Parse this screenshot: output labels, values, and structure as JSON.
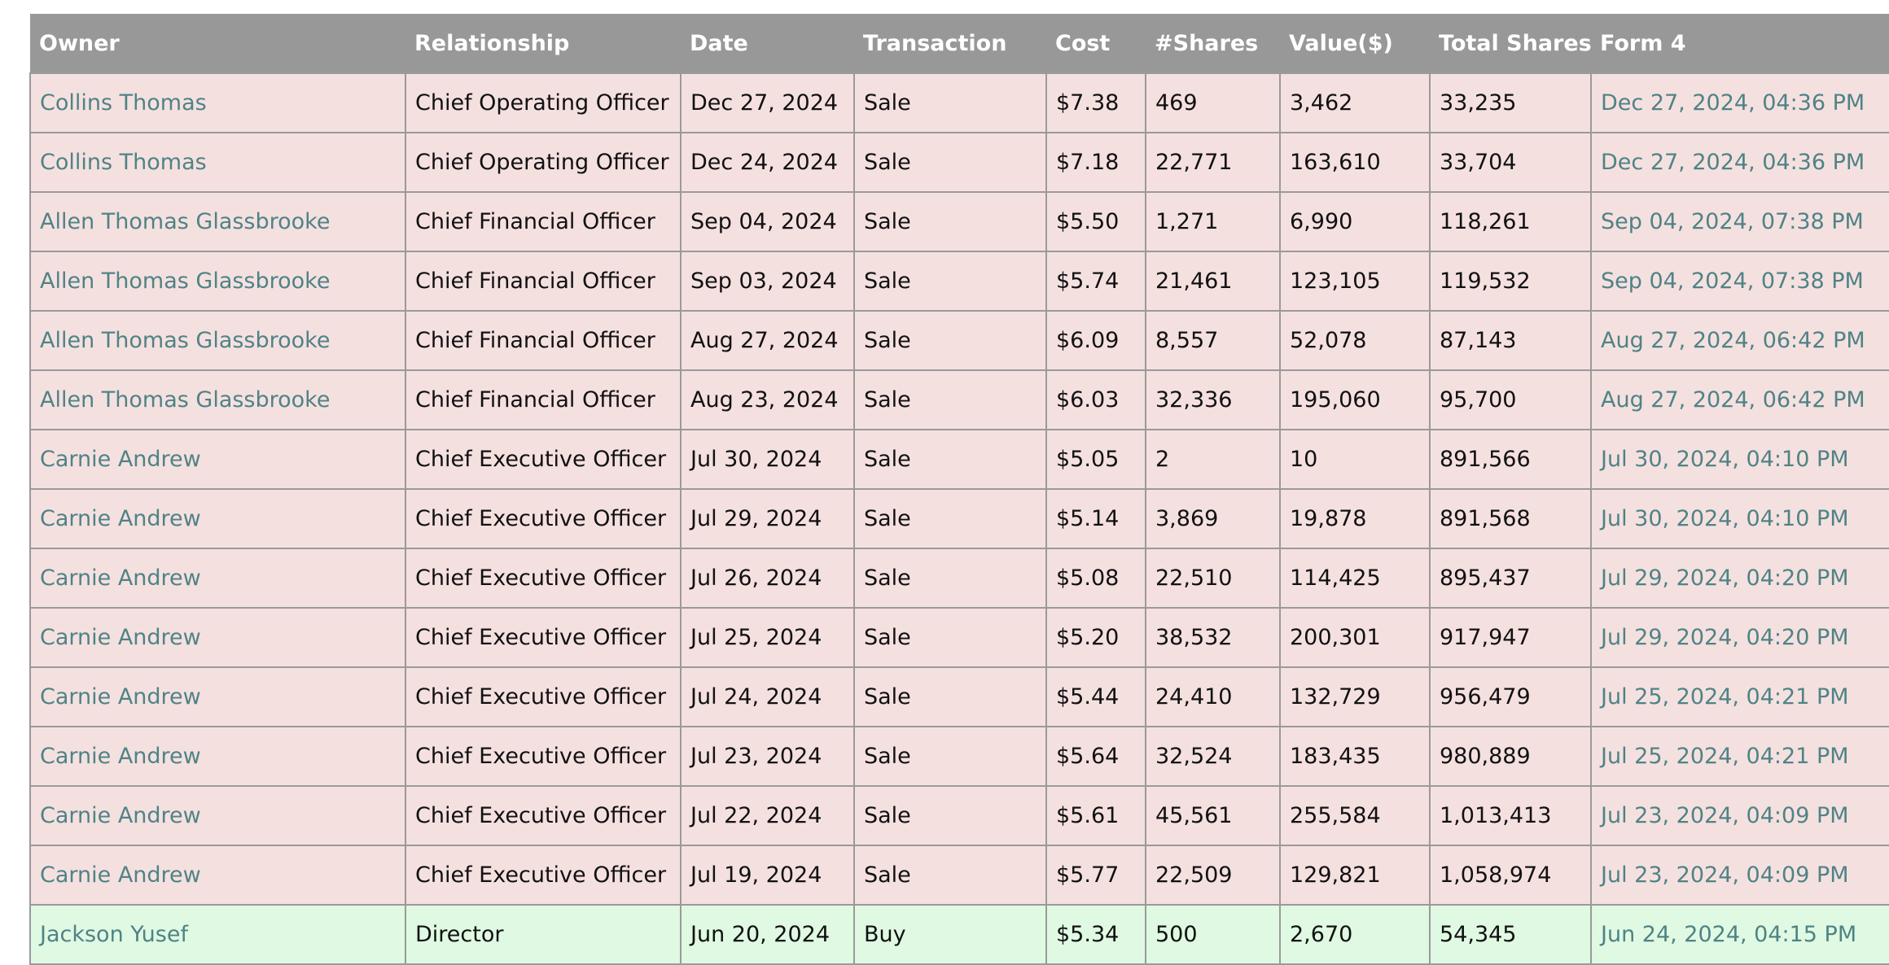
{
  "columns": [
    "Owner",
    "Relationship",
    "Date",
    "Transaction",
    "Cost",
    "#Shares",
    "Value($)",
    "Total Shares",
    "Form 4"
  ],
  "colors": {
    "header_bg": "#989898",
    "sale_row_bg": "#f5e0e0",
    "buy_row_bg": "#dff9e3",
    "link_text": "#4f8385",
    "border": "#9a9a9a"
  },
  "rows": [
    {
      "owner": "Collins Thomas",
      "relationship": "Chief Operating Officer",
      "date": "Dec 27, 2024",
      "transaction": "Sale",
      "cost": "$7.38",
      "shares": "469",
      "value": "3,462",
      "total_shares": "33,235",
      "form4": "Dec 27, 2024, 04:36 PM"
    },
    {
      "owner": "Collins Thomas",
      "relationship": "Chief Operating Officer",
      "date": "Dec 24, 2024",
      "transaction": "Sale",
      "cost": "$7.18",
      "shares": "22,771",
      "value": "163,610",
      "total_shares": "33,704",
      "form4": "Dec 27, 2024, 04:36 PM"
    },
    {
      "owner": "Allen Thomas Glassbrooke",
      "relationship": "Chief Financial Officer",
      "date": "Sep 04, 2024",
      "transaction": "Sale",
      "cost": "$5.50",
      "shares": "1,271",
      "value": "6,990",
      "total_shares": "118,261",
      "form4": "Sep 04, 2024, 07:38 PM"
    },
    {
      "owner": "Allen Thomas Glassbrooke",
      "relationship": "Chief Financial Officer",
      "date": "Sep 03, 2024",
      "transaction": "Sale",
      "cost": "$5.74",
      "shares": "21,461",
      "value": "123,105",
      "total_shares": "119,532",
      "form4": "Sep 04, 2024, 07:38 PM"
    },
    {
      "owner": "Allen Thomas Glassbrooke",
      "relationship": "Chief Financial Officer",
      "date": "Aug 27, 2024",
      "transaction": "Sale",
      "cost": "$6.09",
      "shares": "8,557",
      "value": "52,078",
      "total_shares": "87,143",
      "form4": "Aug 27, 2024, 06:42 PM"
    },
    {
      "owner": "Allen Thomas Glassbrooke",
      "relationship": "Chief Financial Officer",
      "date": "Aug 23, 2024",
      "transaction": "Sale",
      "cost": "$6.03",
      "shares": "32,336",
      "value": "195,060",
      "total_shares": "95,700",
      "form4": "Aug 27, 2024, 06:42 PM"
    },
    {
      "owner": "Carnie Andrew",
      "relationship": "Chief Executive Officer",
      "date": "Jul 30, 2024",
      "transaction": "Sale",
      "cost": "$5.05",
      "shares": "2",
      "value": "10",
      "total_shares": "891,566",
      "form4": "Jul 30, 2024, 04:10 PM"
    },
    {
      "owner": "Carnie Andrew",
      "relationship": "Chief Executive Officer",
      "date": "Jul 29, 2024",
      "transaction": "Sale",
      "cost": "$5.14",
      "shares": "3,869",
      "value": "19,878",
      "total_shares": "891,568",
      "form4": "Jul 30, 2024, 04:10 PM"
    },
    {
      "owner": "Carnie Andrew",
      "relationship": "Chief Executive Officer",
      "date": "Jul 26, 2024",
      "transaction": "Sale",
      "cost": "$5.08",
      "shares": "22,510",
      "value": "114,425",
      "total_shares": "895,437",
      "form4": "Jul 29, 2024, 04:20 PM"
    },
    {
      "owner": "Carnie Andrew",
      "relationship": "Chief Executive Officer",
      "date": "Jul 25, 2024",
      "transaction": "Sale",
      "cost": "$5.20",
      "shares": "38,532",
      "value": "200,301",
      "total_shares": "917,947",
      "form4": "Jul 29, 2024, 04:20 PM"
    },
    {
      "owner": "Carnie Andrew",
      "relationship": "Chief Executive Officer",
      "date": "Jul 24, 2024",
      "transaction": "Sale",
      "cost": "$5.44",
      "shares": "24,410",
      "value": "132,729",
      "total_shares": "956,479",
      "form4": "Jul 25, 2024, 04:21 PM"
    },
    {
      "owner": "Carnie Andrew",
      "relationship": "Chief Executive Officer",
      "date": "Jul 23, 2024",
      "transaction": "Sale",
      "cost": "$5.64",
      "shares": "32,524",
      "value": "183,435",
      "total_shares": "980,889",
      "form4": "Jul 25, 2024, 04:21 PM"
    },
    {
      "owner": "Carnie Andrew",
      "relationship": "Chief Executive Officer",
      "date": "Jul 22, 2024",
      "transaction": "Sale",
      "cost": "$5.61",
      "shares": "45,561",
      "value": "255,584",
      "total_shares": "1,013,413",
      "form4": "Jul 23, 2024, 04:09 PM"
    },
    {
      "owner": "Carnie Andrew",
      "relationship": "Chief Executive Officer",
      "date": "Jul 19, 2024",
      "transaction": "Sale",
      "cost": "$5.77",
      "shares": "22,509",
      "value": "129,821",
      "total_shares": "1,058,974",
      "form4": "Jul 23, 2024, 04:09 PM"
    },
    {
      "owner": "Jackson Yusef",
      "relationship": "Director",
      "date": "Jun 20, 2024",
      "transaction": "Buy",
      "cost": "$5.34",
      "shares": "500",
      "value": "2,670",
      "total_shares": "54,345",
      "form4": "Jun 24, 2024, 04:15 PM"
    }
  ]
}
